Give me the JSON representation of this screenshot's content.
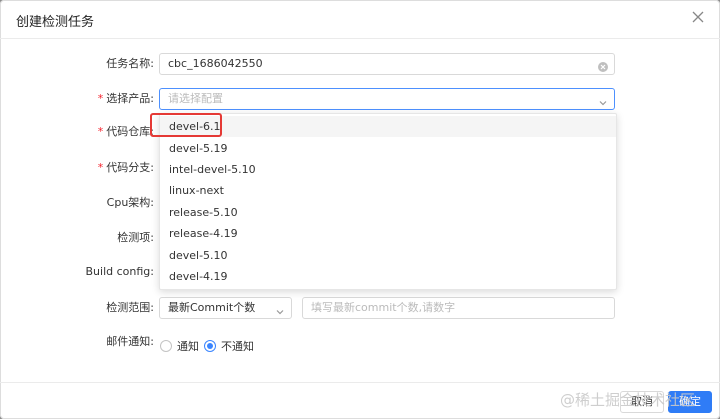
{
  "dialog": {
    "title": "创建检测任务"
  },
  "form": {
    "task_name": {
      "label": "任务名称:",
      "value": "cbc_1686042550"
    },
    "product": {
      "label": "选择产品:",
      "placeholder": "请选择配置"
    },
    "repo": {
      "label": "代码仓库:"
    },
    "branch": {
      "label": "代码分支:"
    },
    "cpu": {
      "label": "Cpu架构:"
    },
    "check_items": {
      "label": "检测项:"
    },
    "build_config": {
      "label": "Build config:"
    },
    "scope": {
      "label": "检测范围:",
      "select_value": "最新Commit个数",
      "input_placeholder": "填写最新commit个数,请数字"
    },
    "email": {
      "label": "邮件通知:",
      "options": [
        "通知",
        "不通知"
      ],
      "selected": "不通知"
    }
  },
  "dropdown": {
    "options": [
      "devel-6.1",
      "devel-5.19",
      "intel-devel-5.10",
      "linux-next",
      "release-5.10",
      "release-4.19",
      "devel-5.10",
      "devel-4.19"
    ],
    "highlighted": "devel-6.1"
  },
  "footer": {
    "cancel_label": "取消",
    "ok_label": "确定"
  },
  "watermark": "@稀土掘金技术社区",
  "colors": {
    "required": "#f5222d",
    "primary": "#2f7cf6",
    "annotation": "#e53935"
  }
}
